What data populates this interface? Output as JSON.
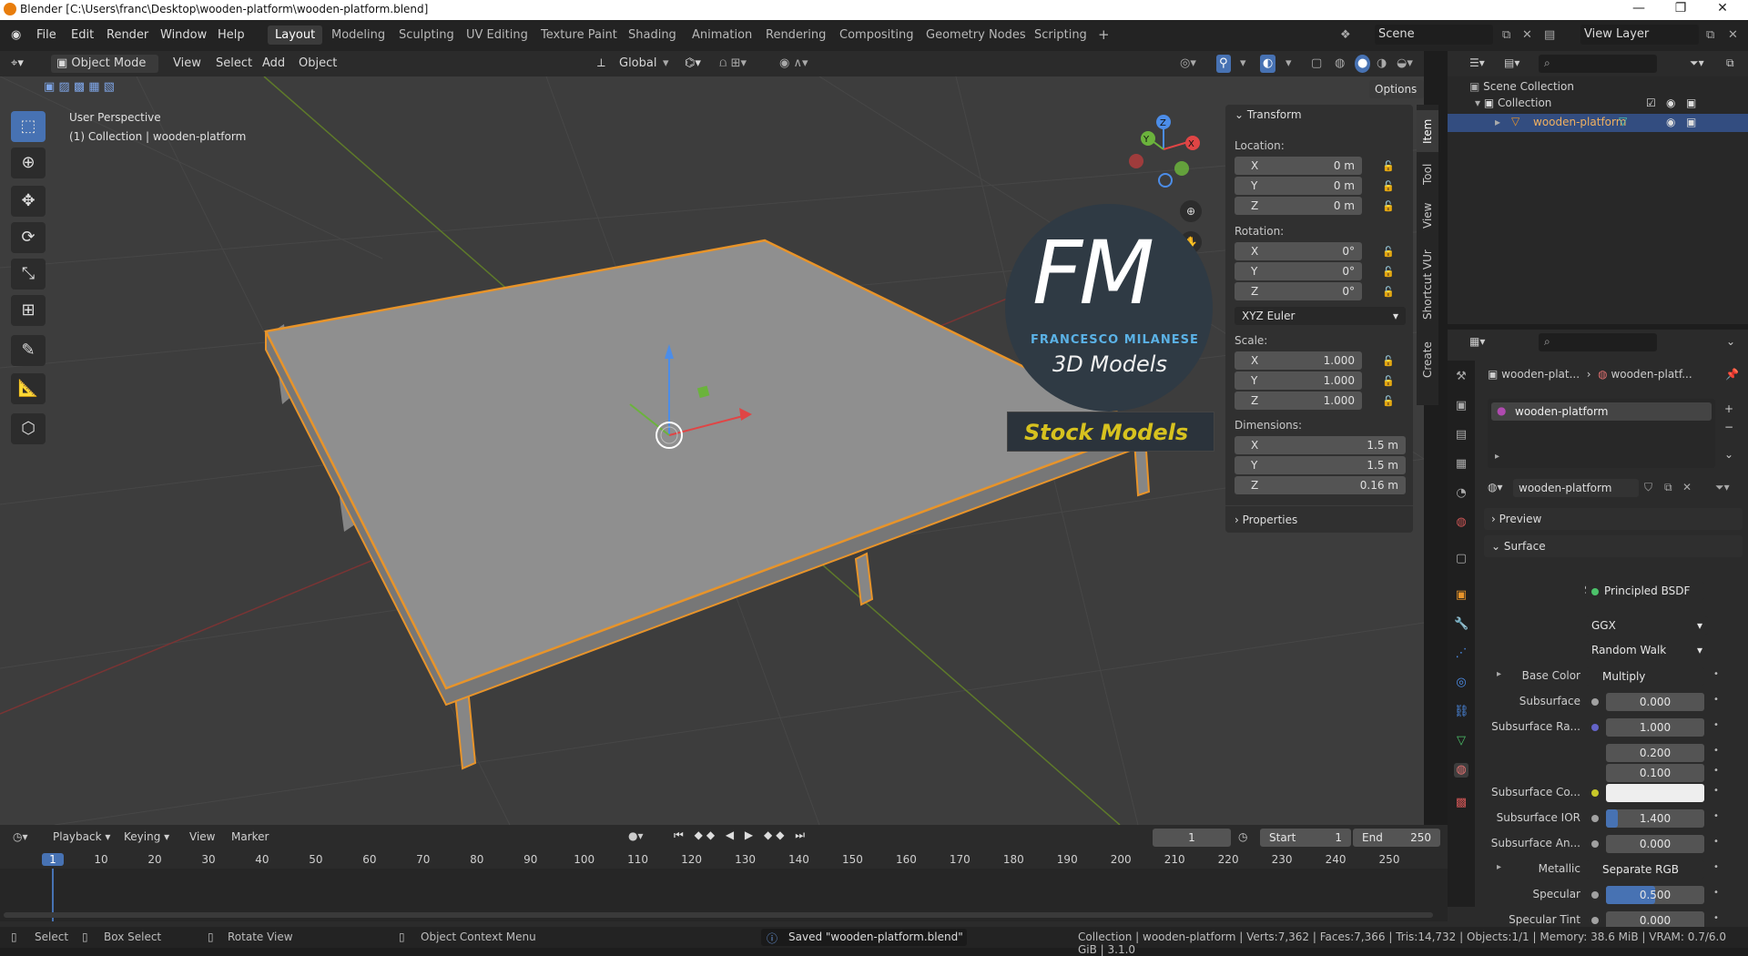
{
  "window": {
    "title": "Blender [C:\\Users\\franc\\Desktop\\wooden-platform\\wooden-platform.blend]"
  },
  "menu": {
    "items": [
      "File",
      "Edit",
      "Render",
      "Window",
      "Help"
    ]
  },
  "workspaces": [
    "Layout",
    "Modeling",
    "Sculpting",
    "UV Editing",
    "Texture Paint",
    "Shading",
    "Animation",
    "Rendering",
    "Compositing",
    "Geometry Nodes",
    "Scripting",
    "+"
  ],
  "scene": {
    "label": "Scene",
    "view_layer": "View Layer"
  },
  "viewport_header": {
    "mode": "Object Mode",
    "view": "View",
    "select": "Select",
    "add": "Add",
    "object": "Object",
    "orientation": "Global",
    "options": "Options"
  },
  "viewport": {
    "perspective": "User Perspective",
    "collection_info": "(1) Collection | wooden-platform"
  },
  "watermark": {
    "letters": "FM",
    "name": "FRANCESCO MILANESE",
    "sub": "3D Models",
    "stock": "Stock Models"
  },
  "npanel": {
    "transform": "Transform",
    "location_label": "Location:",
    "location": [
      {
        "k": "X",
        "v": "0 m"
      },
      {
        "k": "Y",
        "v": "0 m"
      },
      {
        "k": "Z",
        "v": "0 m"
      }
    ],
    "rotation_label": "Rotation:",
    "rotation": [
      {
        "k": "X",
        "v": "0°"
      },
      {
        "k": "Y",
        "v": "0°"
      },
      {
        "k": "Z",
        "v": "0°"
      }
    ],
    "rotation_mode": "XYZ Euler",
    "scale_label": "Scale:",
    "scale": [
      {
        "k": "X",
        "v": "1.000"
      },
      {
        "k": "Y",
        "v": "1.000"
      },
      {
        "k": "Z",
        "v": "1.000"
      }
    ],
    "dimensions_label": "Dimensions:",
    "dimensions": [
      {
        "k": "X",
        "v": "1.5 m"
      },
      {
        "k": "Y",
        "v": "1.5 m"
      },
      {
        "k": "Z",
        "v": "0.16 m"
      }
    ],
    "properties": "Properties",
    "tabs": [
      "Item",
      "Tool",
      "View",
      "Shortcut VUr",
      "Create"
    ]
  },
  "outliner": {
    "scene_collection": "Scene Collection",
    "collection": "Collection",
    "object": "wooden-platform"
  },
  "properties": {
    "breadcrumb1": "wooden-plat...",
    "breadcrumb2": "wooden-platf...",
    "slot": "wooden-platform",
    "material": "wooden-platform",
    "preview": "Preview",
    "surface_section": "Surface",
    "surface_label": "Surface",
    "surface_value": "Principled BSDF",
    "distribution": "GGX",
    "subsurface_method": "Random Walk",
    "rows": [
      {
        "label": "Base Color",
        "value": "Multiply",
        "kind": "link",
        "dot": "#c7c729"
      },
      {
        "label": "Subsurface",
        "value": "0.000",
        "kind": "num",
        "dot": "#a1a1a1"
      },
      {
        "label": "Subsurface Ra...",
        "value": "1.000",
        "kind": "num",
        "dot": "#6363c7"
      },
      {
        "label": "",
        "value": "0.200",
        "kind": "num",
        "dot": ""
      },
      {
        "label": "",
        "value": "0.100",
        "kind": "num",
        "dot": ""
      },
      {
        "label": "Subsurface Co...",
        "value": "",
        "kind": "color",
        "dot": "#c7c729"
      },
      {
        "label": "Subsurface IOR",
        "value": "1.400",
        "kind": "bar",
        "dot": "#a1a1a1"
      },
      {
        "label": "Subsurface An...",
        "value": "0.000",
        "kind": "num",
        "dot": "#a1a1a1"
      },
      {
        "label": "Metallic",
        "value": "Separate RGB",
        "kind": "link",
        "dot": "#a1a1a1"
      },
      {
        "label": "Specular",
        "value": "0.500",
        "kind": "bar",
        "dot": "#a1a1a1"
      },
      {
        "label": "Specular Tint",
        "value": "0.000",
        "kind": "num",
        "dot": "#a1a1a1"
      }
    ]
  },
  "timeline": {
    "playback": "Playback",
    "keying": "Keying",
    "view": "View",
    "marker": "Marker",
    "current_frame": "1",
    "start_label": "Start",
    "start": "1",
    "end_label": "End",
    "end": "250",
    "ticks": [
      "1",
      "10",
      "20",
      "30",
      "40",
      "50",
      "60",
      "70",
      "80",
      "90",
      "100",
      "110",
      "120",
      "130",
      "140",
      "150",
      "160",
      "170",
      "180",
      "190",
      "200",
      "210",
      "220",
      "230",
      "240",
      "250"
    ]
  },
  "status": {
    "select": "Select",
    "box_select": "Box Select",
    "rotate": "Rotate View",
    "context": "Object Context Menu",
    "message": "Saved \"wooden-platform.blend\"",
    "stats": "Collection | wooden-platform | Verts:7,362 | Faces:7,366 | Tris:14,732 | Objects:1/1 | Memory: 38.6 MiB | VRAM: 0.7/6.0 GiB | 3.1.0"
  },
  "colors": {
    "accent": "#4772b3",
    "selection": "#e8942a",
    "active_row": "#334d80"
  }
}
